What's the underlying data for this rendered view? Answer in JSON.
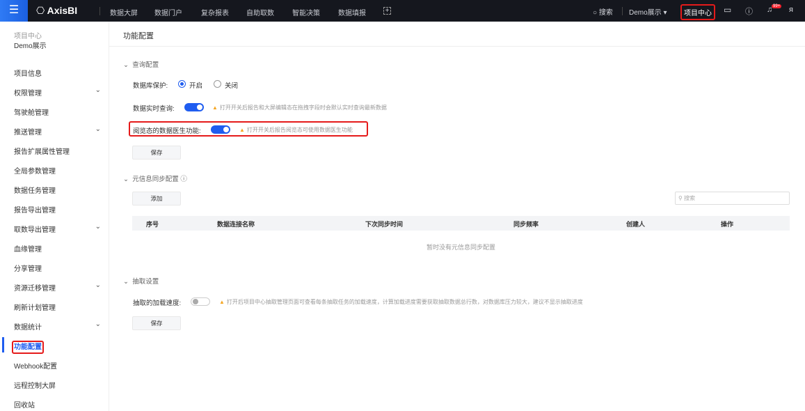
{
  "topbar": {
    "brand": "AxisBI",
    "nav": [
      "数据大屏",
      "数据门户",
      "复杂报表",
      "自助取数",
      "智能决策",
      "数据填报"
    ],
    "search": "搜索",
    "project": "Demo展示",
    "project_center": "项目中心",
    "badge": "99+"
  },
  "sidebar": {
    "section": "项目中心",
    "project": "Demo展示",
    "items": [
      {
        "label": "项目信息",
        "chev": false
      },
      {
        "label": "权限管理",
        "chev": true
      },
      {
        "label": "驾驶舱管理",
        "chev": false
      },
      {
        "label": "推送管理",
        "chev": true
      },
      {
        "label": "报告扩展属性管理",
        "chev": false
      },
      {
        "label": "全局参数管理",
        "chev": false
      },
      {
        "label": "数据任务管理",
        "chev": false
      },
      {
        "label": "报告导出管理",
        "chev": false
      },
      {
        "label": "取数导出管理",
        "chev": true
      },
      {
        "label": "血缘管理",
        "chev": false
      },
      {
        "label": "分享管理",
        "chev": false
      },
      {
        "label": "资源迁移管理",
        "chev": true
      },
      {
        "label": "刷新计划管理",
        "chev": false
      },
      {
        "label": "数据统计",
        "chev": true
      },
      {
        "label": "功能配置",
        "chev": false
      },
      {
        "label": "Webhook配置",
        "chev": false
      },
      {
        "label": "远程控制大屏",
        "chev": false
      },
      {
        "label": "回收站",
        "chev": false
      }
    ],
    "active": "功能配置"
  },
  "main": {
    "title": "功能配置",
    "query": {
      "title": "查询配置",
      "db_protect": "数据库保护:",
      "on": "开启",
      "off": "关闭",
      "realtime": "数据实时查询:",
      "realtime_tip": "打开开关后报告和大屏编辑态在拖拽字段时会默认实时查询最新数据",
      "doctor": "阅览态的数据医生功能:",
      "doctor_tip": "打开开关后报告阅览态可使用数据医生功能",
      "save": "保存"
    },
    "meta": {
      "title": "元信息同步配置",
      "add": "添加",
      "search_placeholder": "搜索",
      "columns": [
        "序号",
        "数据连接名称",
        "下次同步时间",
        "同步频率",
        "创建人",
        "操作"
      ],
      "empty": "暂时没有元信息同步配置"
    },
    "extract": {
      "title": "抽取设置",
      "speed": "抽取的加载速度:",
      "speed_tip": "打开后项目中心抽取管理页面可查看每条抽取任务的加载速度，计算加载进度需要获取抽取数据总行数，对数据库压力较大，建议不显示抽取进度",
      "save": "保存"
    }
  }
}
